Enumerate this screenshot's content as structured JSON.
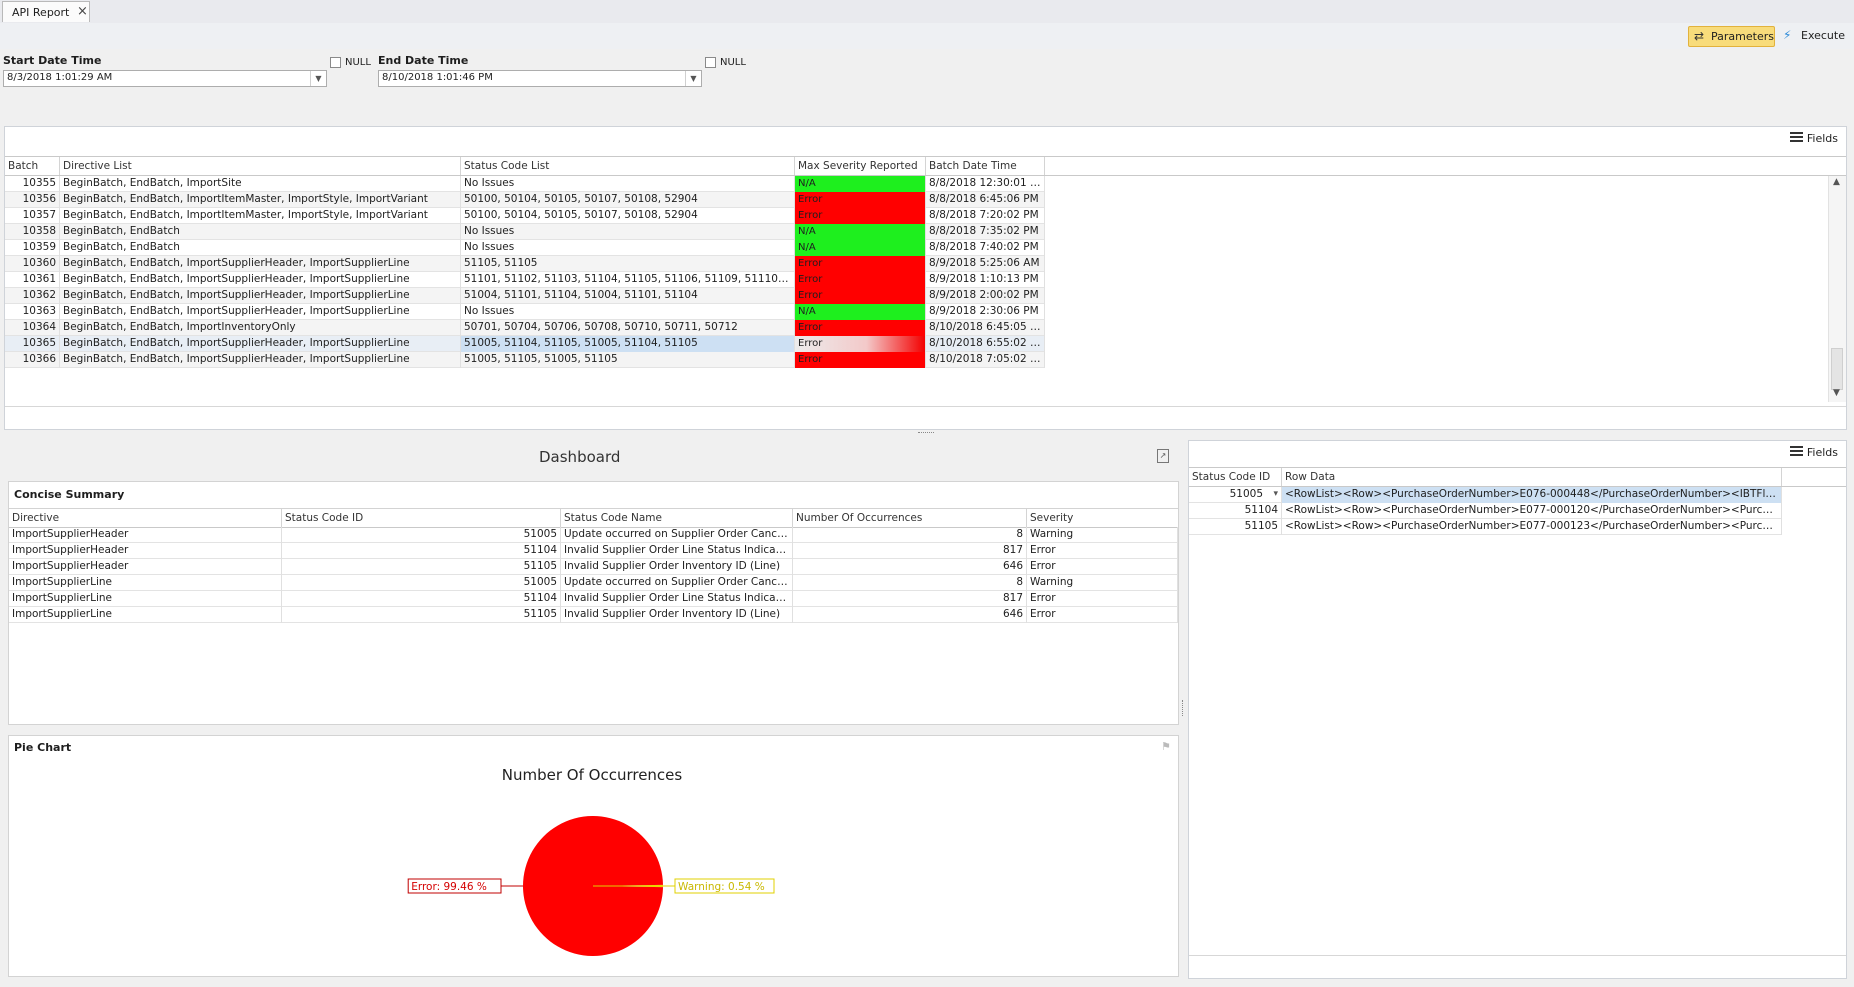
{
  "tabs": [
    {
      "label": "API Report"
    }
  ],
  "toolbar": {
    "parameters_label": "Parameters",
    "execute_label": "Execute"
  },
  "params": {
    "start": {
      "label": "Start Date Time",
      "value": "8/3/2018 1:01:29 AM",
      "null_label": "NULL"
    },
    "end": {
      "label": "End Date Time",
      "value": "8/10/2018 1:01:46 PM",
      "null_label": "NULL"
    }
  },
  "batch_grid": {
    "fields_label": "Fields",
    "columns": [
      "Batch",
      "Directive List",
      "Status Code List",
      "Max Severity Reported",
      "Batch Date Time"
    ],
    "rows": [
      {
        "batch": "10355",
        "directives": "BeginBatch, EndBatch, ImportSite",
        "codes": "No Issues",
        "severity": "N/A",
        "date": "8/8/2018 12:30:01 PM"
      },
      {
        "batch": "10356",
        "directives": "BeginBatch, EndBatch, ImportItemMaster, ImportStyle, ImportVariant",
        "codes": "50100, 50104, 50105, 50107, 50108, 52904",
        "severity": "Error",
        "date": "8/8/2018 6:45:06 PM"
      },
      {
        "batch": "10357",
        "directives": "BeginBatch, EndBatch, ImportItemMaster, ImportStyle, ImportVariant",
        "codes": "50100, 50104, 50105, 50107, 50108, 52904",
        "severity": "Error",
        "date": "8/8/2018 7:20:02 PM"
      },
      {
        "batch": "10358",
        "directives": "BeginBatch, EndBatch",
        "codes": "No Issues",
        "severity": "N/A",
        "date": "8/8/2018 7:35:02 PM"
      },
      {
        "batch": "10359",
        "directives": "BeginBatch, EndBatch",
        "codes": "No Issues",
        "severity": "N/A",
        "date": "8/8/2018 7:40:02 PM"
      },
      {
        "batch": "10360",
        "directives": "BeginBatch, EndBatch, ImportSupplierHeader, ImportSupplierLine",
        "codes": "51105, 51105",
        "severity": "Error",
        "date": "8/9/2018 5:25:06 AM"
      },
      {
        "batch": "10361",
        "directives": "BeginBatch, EndBatch, ImportSupplierHeader, ImportSupplierLine",
        "codes": "51101, 51102, 51103, 51104, 51105, 51106, 51109, 51110, 511...",
        "severity": "Error",
        "date": "8/9/2018 1:10:13 PM"
      },
      {
        "batch": "10362",
        "directives": "BeginBatch, EndBatch, ImportSupplierHeader, ImportSupplierLine",
        "codes": "51004, 51101, 51104, 51004, 51101, 51104",
        "severity": "Error",
        "date": "8/9/2018 2:00:02 PM"
      },
      {
        "batch": "10363",
        "directives": "BeginBatch, EndBatch, ImportSupplierHeader, ImportSupplierLine",
        "codes": "No Issues",
        "severity": "N/A",
        "date": "8/9/2018 2:30:06 PM"
      },
      {
        "batch": "10364",
        "directives": "BeginBatch, EndBatch, ImportInventoryOnly",
        "codes": "50701, 50704, 50706, 50708, 50710, 50711, 50712",
        "severity": "Error",
        "date": "8/10/2018 6:45:05 AM"
      },
      {
        "batch": "10365",
        "directives": "BeginBatch, EndBatch, ImportSupplierHeader, ImportSupplierLine",
        "codes": "51005, 51104, 51105, 51005, 51104, 51105",
        "severity": "Error",
        "date": "8/10/2018 6:55:02 AM",
        "selected": true
      },
      {
        "batch": "10366",
        "directives": "BeginBatch, EndBatch, ImportSupplierHeader, ImportSupplierLine",
        "codes": "51005, 51105, 51005, 51105",
        "severity": "Error",
        "date": "8/10/2018 7:05:02 AM"
      }
    ]
  },
  "dashboard": {
    "title": "Dashboard",
    "summary": {
      "title": "Concise Summary",
      "columns": [
        "Directive",
        "Status Code ID",
        "Status Code Name",
        "Number Of Occurrences",
        "Severity"
      ],
      "rows": [
        {
          "directive": "ImportSupplierHeader",
          "code": "51005",
          "name": "Update occurred on Supplier Order Cancelle...",
          "count": "8",
          "severity": "Warning"
        },
        {
          "directive": "ImportSupplierHeader",
          "code": "51104",
          "name": "Invalid Supplier Order Line Status Indicator ...",
          "count": "817",
          "severity": "Error"
        },
        {
          "directive": "ImportSupplierHeader",
          "code": "51105",
          "name": "Invalid Supplier Order Inventory ID (Line)",
          "count": "646",
          "severity": "Error"
        },
        {
          "directive": "ImportSupplierLine",
          "code": "51005",
          "name": "Update occurred on Supplier Order Cancelle...",
          "count": "8",
          "severity": "Warning"
        },
        {
          "directive": "ImportSupplierLine",
          "code": "51104",
          "name": "Invalid Supplier Order Line Status Indicator ...",
          "count": "817",
          "severity": "Error"
        },
        {
          "directive": "ImportSupplierLine",
          "code": "51105",
          "name": "Invalid Supplier Order Inventory ID (Line)",
          "count": "646",
          "severity": "Error"
        }
      ]
    },
    "pie": {
      "panel_title": "Pie Chart",
      "chart_data": {
        "type": "pie",
        "title": "Number Of Occurrences",
        "slices": [
          {
            "name": "Error",
            "value": 99.46,
            "label": "Error: 99.46 %",
            "color": "#ff0000"
          },
          {
            "name": "Warning",
            "value": 0.54,
            "label": "Warning: 0.54 %",
            "color": "#f5e200"
          }
        ]
      }
    }
  },
  "detail_grid": {
    "fields_label": "Fields",
    "columns": [
      "Status Code ID",
      "Row Data"
    ],
    "rows": [
      {
        "code": "51005",
        "data": "<RowList><Row><PurchaseOrderNumber>E076-000448</PurchaseOrderNumber><IBTFlag>1</...",
        "selected": true
      },
      {
        "code": "51104",
        "data": "<RowList><Row><PurchaseOrderNumber>E077-000120</PurchaseOrderNumber><PurchaseOrd..."
      },
      {
        "code": "51105",
        "data": "<RowList><Row><PurchaseOrderNumber>E077-000123</PurchaseOrderNumber><PurchaseOrd..."
      }
    ]
  },
  "colors": {
    "ok": "#1eef1e",
    "error": "#ff0000",
    "warning": "#f5e200",
    "selection": "#cde0f3",
    "accent": "#f8dc7b"
  }
}
